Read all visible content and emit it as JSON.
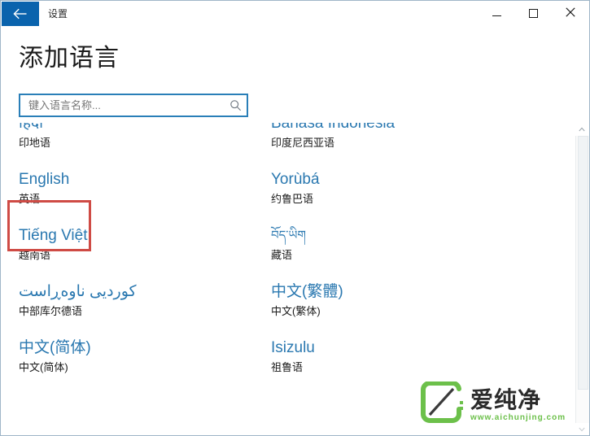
{
  "window": {
    "title": "设置",
    "back_icon": "back-arrow-icon",
    "minimize_label": "最小化",
    "maximize_label": "最大化",
    "close_label": "关闭"
  },
  "page": {
    "title": "添加语言"
  },
  "search": {
    "value": "",
    "placeholder": "键入语言名称...",
    "icon": "search-icon"
  },
  "list": {
    "clipped_top_row": {
      "left_native": "",
      "right_native": ""
    },
    "items": [
      {
        "native": "हिंदी",
        "chinese": "印地语",
        "script": "devanagari",
        "selected": false
      },
      {
        "native": "Bahasa Indonesia",
        "chinese": "印度尼西亚语",
        "script": "latin",
        "selected": false
      },
      {
        "native": "English",
        "chinese": "英语",
        "script": "latin",
        "selected": true
      },
      {
        "native": "Yorùbá",
        "chinese": "约鲁巴语",
        "script": "latin",
        "selected": false
      },
      {
        "native": "Tiếng Việt",
        "chinese": "越南语",
        "script": "latin",
        "selected": false
      },
      {
        "native": "བོད་ཡིག",
        "chinese": "藏语",
        "script": "tibetan",
        "selected": false
      },
      {
        "native": "کوردیی ناوەڕاست",
        "chinese": "中部库尔德语",
        "script": "arabic",
        "selected": false
      },
      {
        "native": "中文(繁體)",
        "chinese": "中文(繁体)",
        "script": "han",
        "selected": false
      },
      {
        "native": "中文(简体)",
        "chinese": "中文(简体)",
        "script": "han",
        "selected": false
      },
      {
        "native": "Isizulu",
        "chinese": "祖鲁语",
        "script": "latin",
        "selected": false
      }
    ]
  },
  "selection": {
    "highlighted_label": "English",
    "highlight_color": "#cf4b45"
  },
  "scrollbar": {
    "up_icon": "chevron-up-icon",
    "down_icon": "chevron-down-icon"
  },
  "watermark": {
    "brand": "爱纯净",
    "url": "www.aichunjing.com",
    "logo_color": "#6cc04a"
  },
  "colors": {
    "accent": "#2a78b0",
    "titlebar_back": "#0a63ad",
    "search_border": "#2a7fb8",
    "highlight": "#cf4b45",
    "watermark_green": "#6cc04a"
  }
}
